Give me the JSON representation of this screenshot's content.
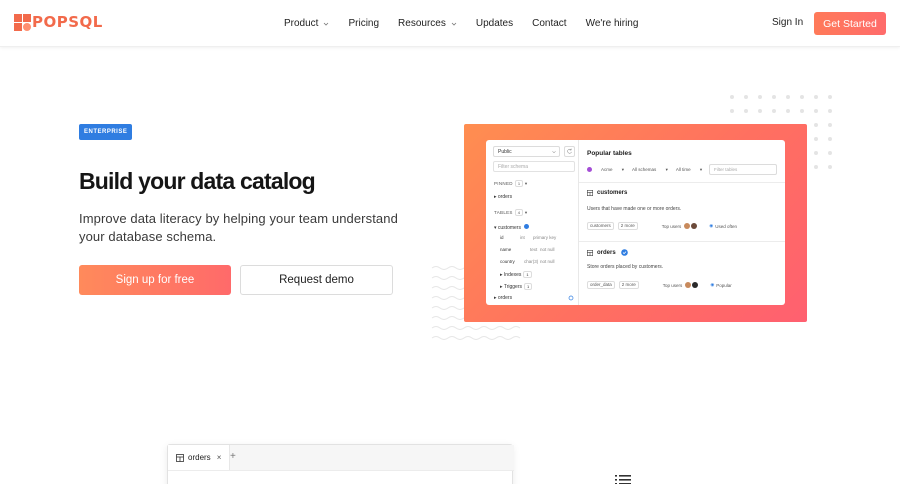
{
  "nav": {
    "logo_text": "POPSQL",
    "links": [
      "Product",
      "Pricing",
      "Resources",
      "Updates",
      "Contact",
      "We're hiring"
    ],
    "sign_in": "Sign In",
    "get_started": "Get Started"
  },
  "hero": {
    "badge": "ENTERPRISE",
    "title": "Build your data catalog",
    "subtitle": "Improve data literacy by helping your team understand your database schema.",
    "signup_button": "Sign up for free",
    "demo_button": "Request demo"
  },
  "app_preview": {
    "schema_select": "Public",
    "filter_schema_placeholder": "Filter schema",
    "pinned_label": "PINNED",
    "pinned_count": "1",
    "pinned_item": "orders",
    "tables_label": "TABLES",
    "tables_count": "4",
    "tree_table": "customers",
    "columns": [
      {
        "name": "id",
        "type": "int",
        "note": "primary key"
      },
      {
        "name": "name",
        "type": "text",
        "note": "not null"
      },
      {
        "name": "country",
        "type": "char(3)",
        "note": "not null"
      }
    ],
    "indexes_label": "Indexes",
    "indexes_count": "1",
    "triggers_label": "Triggers",
    "triggers_count": "1",
    "last_item": "orders",
    "popular_title": "Popular tables",
    "filter_org": "Acme",
    "filter_schemas": "All schemas",
    "filter_time": "All time",
    "filter_tables_placeholder": "Filter tables",
    "tables": [
      {
        "name": "customers",
        "description": "Users that have made one or more orders.",
        "tag": "customers",
        "more": "2 more",
        "top_users_label": "Top users",
        "status": "Used often"
      },
      {
        "name": "orders",
        "description": "Store orders placed by customers.",
        "tag": "order_data",
        "more": "2 more",
        "top_users_label": "Top users",
        "status": "Popular"
      }
    ]
  },
  "bottom_preview": {
    "tab_label": "orders",
    "close": "×",
    "plus": "+"
  },
  "colors": {
    "brand": "#f26a4b",
    "accent_blue": "#2f7de1",
    "gradient_start": "#ff8a5b",
    "gradient_end": "#ff6a6a"
  }
}
